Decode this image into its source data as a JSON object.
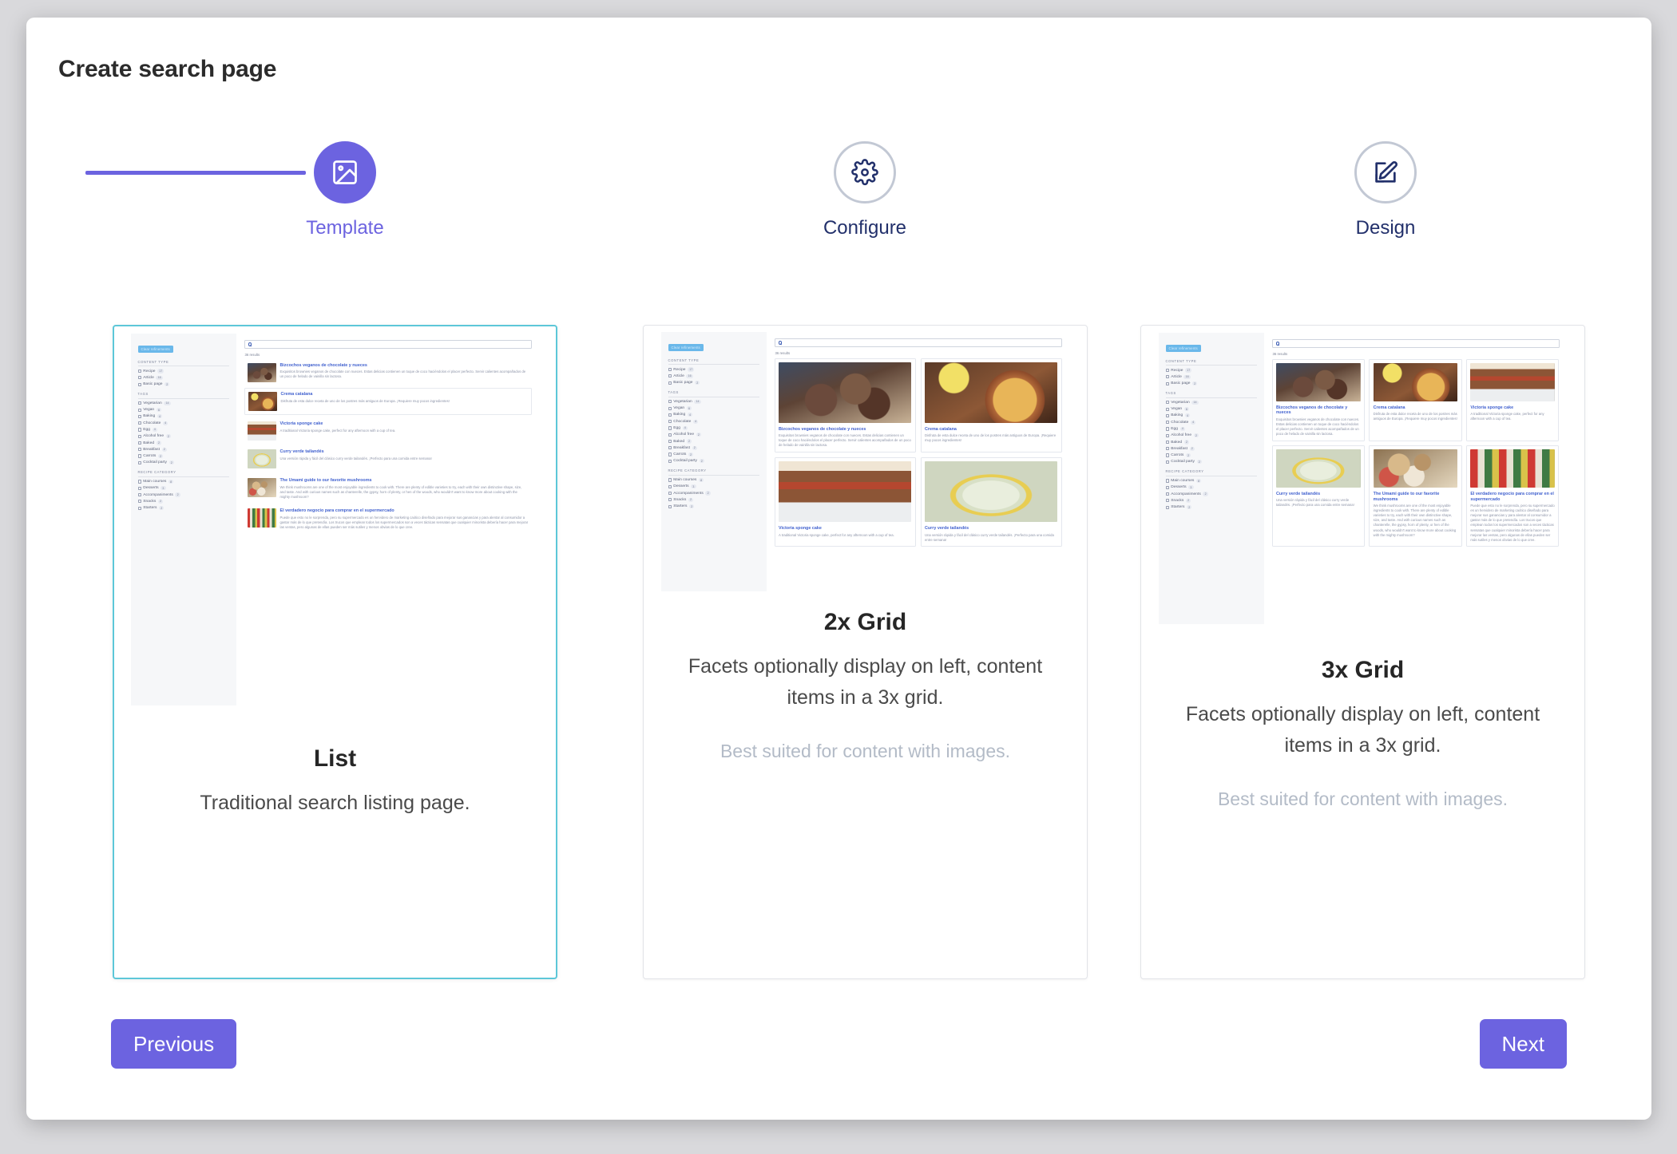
{
  "page": {
    "title": "Create search page"
  },
  "stepper": {
    "steps": [
      {
        "label": "Template",
        "icon": "image-icon",
        "state": "active"
      },
      {
        "label": "Configure",
        "icon": "gear-icon",
        "state": "idle"
      },
      {
        "label": "Design",
        "icon": "edit-square-icon",
        "state": "idle"
      }
    ],
    "accent_color": "#6c63e0",
    "idle_color": "#22306b",
    "idle_ring_color": "#c2c8d4"
  },
  "templates": [
    {
      "id": "list",
      "title": "List",
      "description": "Traditional search listing page.",
      "note": "",
      "selected": true,
      "selected_border_color": "#5dc7d8"
    },
    {
      "id": "grid-2x",
      "title": "2x Grid",
      "description": "Facets optionally display on left, content items in a 3x grid.",
      "note": "Best suited for content with images.",
      "selected": false
    },
    {
      "id": "grid-3x",
      "title": "3x Grid",
      "description": "Facets optionally display on left, content items in a 3x grid.",
      "note": "Best suited for content with images.",
      "selected": false
    }
  ],
  "preview": {
    "clear_refinements_label": "Clear refinements",
    "search_placeholder": "",
    "results_count_label": "36 results",
    "facet_groups": [
      {
        "heading": "CONTENT TYPE",
        "options": [
          {
            "label": "Recipe",
            "count": "17"
          },
          {
            "label": "Article",
            "count": "16"
          },
          {
            "label": "Basic page",
            "count": "2"
          }
        ]
      },
      {
        "heading": "TAGS",
        "options": [
          {
            "label": "Vegetarian",
            "count": "14"
          },
          {
            "label": "Vegan",
            "count": "6"
          },
          {
            "label": "Baking",
            "count": "4"
          },
          {
            "label": "Chocolate",
            "count": "4"
          },
          {
            "label": "Egg",
            "count": "4"
          },
          {
            "label": "Alcohol free",
            "count": "2"
          },
          {
            "label": "Baked",
            "count": "2"
          },
          {
            "label": "Breakfast",
            "count": "2"
          },
          {
            "label": "Carrots",
            "count": "2"
          },
          {
            "label": "Cocktail party",
            "count": "2"
          }
        ]
      },
      {
        "heading": "RECIPE CATEGORY",
        "options": [
          {
            "label": "Main courses",
            "count": "8"
          },
          {
            "label": "Desserts",
            "count": "3"
          },
          {
            "label": "Accompaniments",
            "count": "2"
          },
          {
            "label": "Snacks",
            "count": "2"
          },
          {
            "label": "Starters",
            "count": "2"
          }
        ]
      }
    ],
    "results": [
      {
        "title": "Bizcochos veganos de chocolate y nueces",
        "desc": "Exquisitos brownies veganos de chocolate con nueces. Estas delicias contienen un toque de coco haciéndolos el placer perfecto. Servir calientes acompañados de un poco de helado de vainilla sin lactosa.",
        "image": "img-brownie"
      },
      {
        "title": "Crema catalana",
        "desc": "Disfruta de esta dulce receta de uno de los postres más antiguos de Europa. ¡Requiere muy pocos ingredientes!",
        "image": "img-crema"
      },
      {
        "title": "Victoria sponge cake",
        "desc": "A traditional Victoria sponge cake, perfect for any afternoon with a cup of tea.",
        "image": "img-sponge"
      },
      {
        "title": "Curry verde tailandés",
        "desc": "Una versión rápida y fácil del clásico curry verde tailandés. ¡Perfecto para una comida entre semana!",
        "image": "img-curry"
      },
      {
        "title": "The Umami guide to our favorite mushrooms",
        "desc": "We think mushrooms are one of the most enjoyable ingredients to cook with. There are plenty of edible varieties to try, each with their own distinctive shape, size, and taste. And with curious names such as chanterelle, the gypsy, horn of plenty, or hen of the woods, who wouldn't want to know more about cooking with the mighty mushroom?",
        "image": "img-mushroom"
      },
      {
        "title": "El verdadero negocio para comprar en el supermercado",
        "desc": "Puede que esto no le sorprenda, pero su supermercado es un hervidero de marketing caótico diseñado para mejorar sus ganancias y para alentar al consumidor a gastar más de lo que pretendía. Los trucos que emplean todos los supermercados son a veces tácticas sensatas que cualquier minorista debería hacer para mejorar las ventas, pero algunas de ellas pueden ser más sutiles y menos obvias de lo que cree.",
        "image": "img-market"
      }
    ]
  },
  "footer": {
    "previous_label": "Previous",
    "next_label": "Next",
    "button_color": "#6c63e0"
  }
}
